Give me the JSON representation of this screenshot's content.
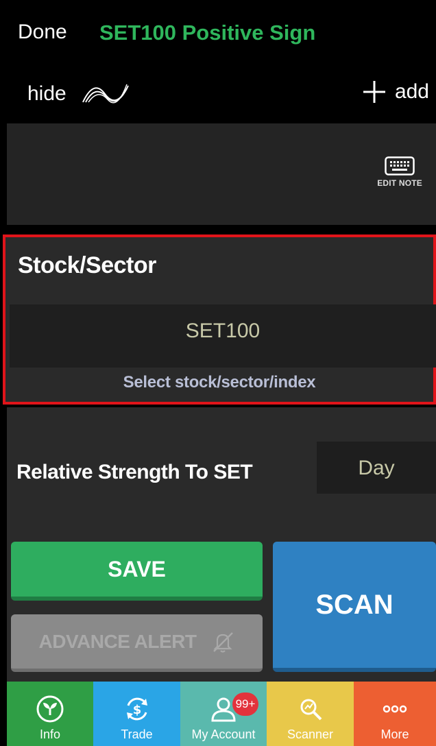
{
  "header": {
    "done_label": "Done",
    "title": "SET100 Positive Sign",
    "hide_label": "hide",
    "add_label": "add"
  },
  "note": {
    "edit_note_label": "EDIT NOTE"
  },
  "stock_sector": {
    "title": "Stock/Sector",
    "value": "SET100",
    "select_label": "Select stock/sector/index"
  },
  "relative_strength": {
    "label": "Relative Strength To SET",
    "period": "Day"
  },
  "buttons": {
    "save_label": "SAVE",
    "advance_alert_label": "ADVANCE ALERT",
    "scan_label": "SCAN"
  },
  "nav": {
    "items": [
      {
        "label": "Info",
        "icon": "plant-icon",
        "color": "#2f9e45"
      },
      {
        "label": "Trade",
        "icon": "dollar-cycle-icon",
        "color": "#2aa5e6"
      },
      {
        "label": "My Account",
        "icon": "user-icon",
        "color": "#5ab9ad",
        "badge": "99+"
      },
      {
        "label": "Scanner",
        "icon": "scanner-icon",
        "color": "#e8c84a"
      },
      {
        "label": "More",
        "icon": "more-dots-icon",
        "color": "#ed5f32"
      }
    ]
  },
  "colors": {
    "title_green": "#2fb65c",
    "highlight_red": "#e0141a",
    "save_green": "#2ead5f",
    "scan_blue": "#2f81c2"
  }
}
